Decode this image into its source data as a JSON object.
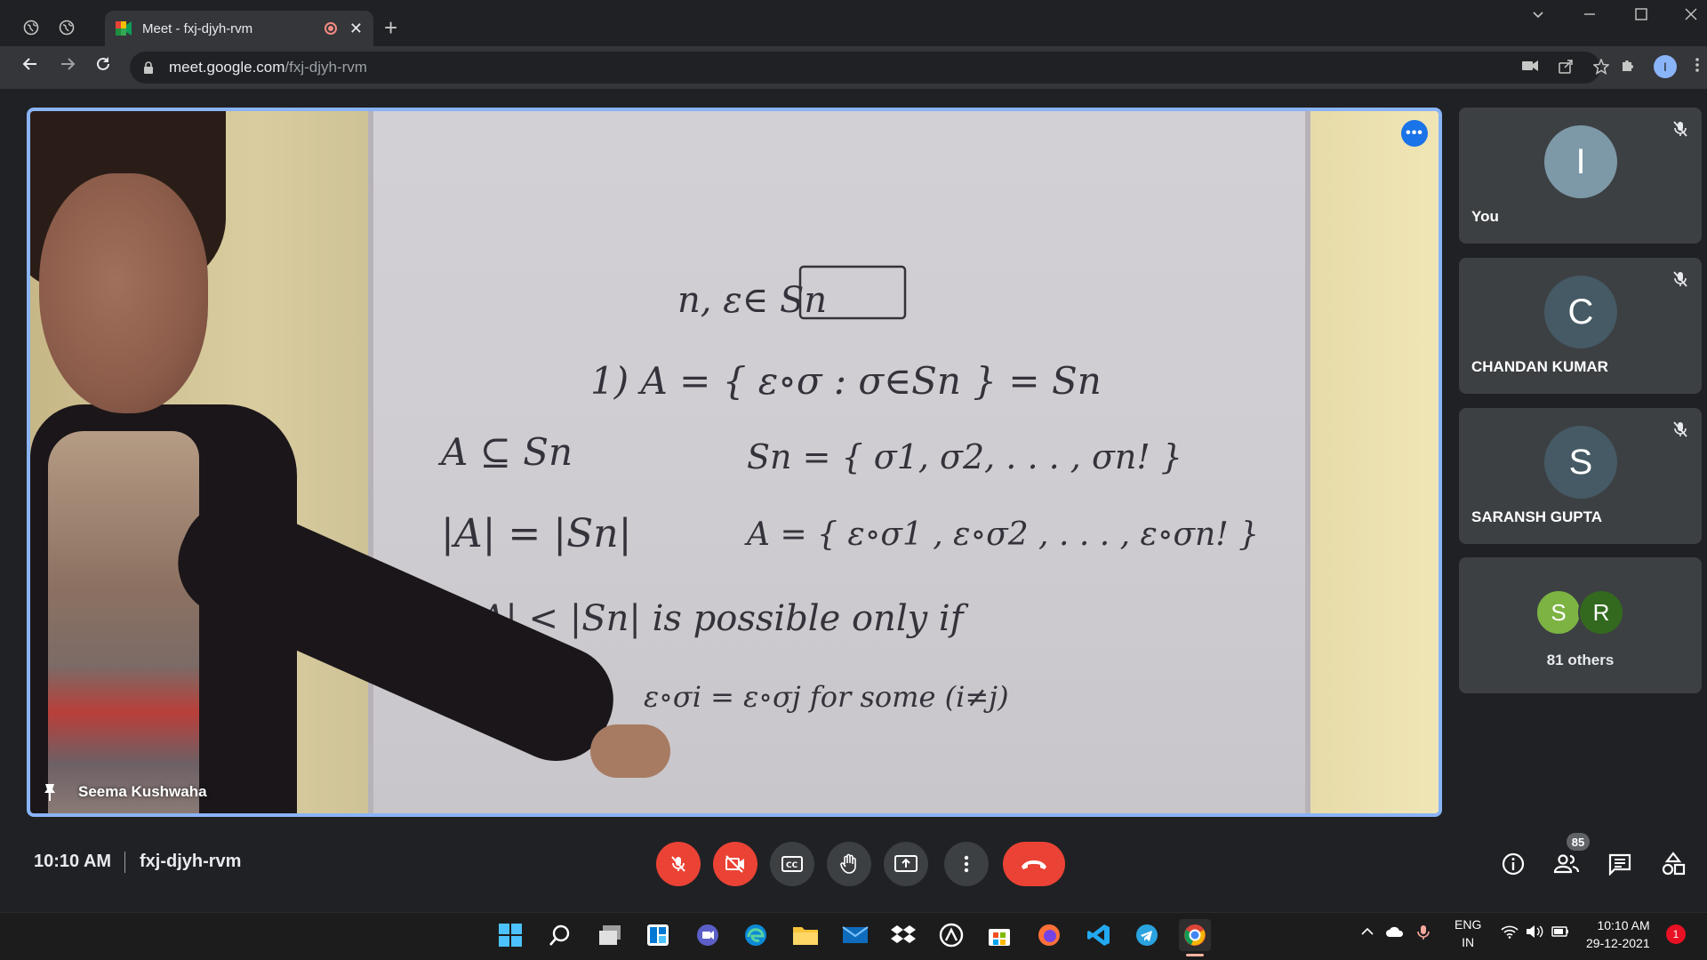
{
  "browser": {
    "tab_title": "Meet - fxj-djyh-rvm",
    "url_host": "meet.google.com",
    "url_path": "/fxj-djyh-rvm",
    "new_tab_symbol": "+",
    "tab_close_symbol": "✕",
    "profile_initial": "I"
  },
  "main_tile": {
    "presenter_name": "Seema Kushwaha",
    "more_symbol": "•••",
    "board_lines": [
      "n, ε∈ Sn",
      "1)  A = { ε∘σ  :  σ∈Sn } = Sn",
      "A ⊆ Sn",
      "Sn = { σ1, σ2, . . . , σn! }",
      "|A| = |Sn|",
      "A = { ε∘σ1 , ε∘σ2 , . . . , ε∘σn! }",
      "|A| < |Sn|  is  possible  only if",
      "ε∘σi = ε∘σj    for some  (i≠j)"
    ]
  },
  "participants": [
    {
      "initial": "I",
      "name": "You",
      "color": "#7d99a8"
    },
    {
      "initial": "C",
      "name": "CHANDAN KUMAR",
      "color": "#455a64"
    },
    {
      "initial": "S",
      "name": "SARANSH GUPTA",
      "color": "#455a64"
    }
  ],
  "others": {
    "avatars": [
      {
        "initial": "S",
        "color": "#7cb342"
      },
      {
        "initial": "R",
        "color": "#33691e"
      }
    ],
    "label": "81 others"
  },
  "bottom_bar": {
    "time": "10:10 AM",
    "meeting_code": "fxj-djyh-rvm",
    "people_count": "85"
  },
  "taskbar": {
    "lang_top": "ENG",
    "lang_bottom": "IN",
    "clock_time": "10:10 AM",
    "clock_date": "29-12-2021",
    "notification_count": "1"
  }
}
